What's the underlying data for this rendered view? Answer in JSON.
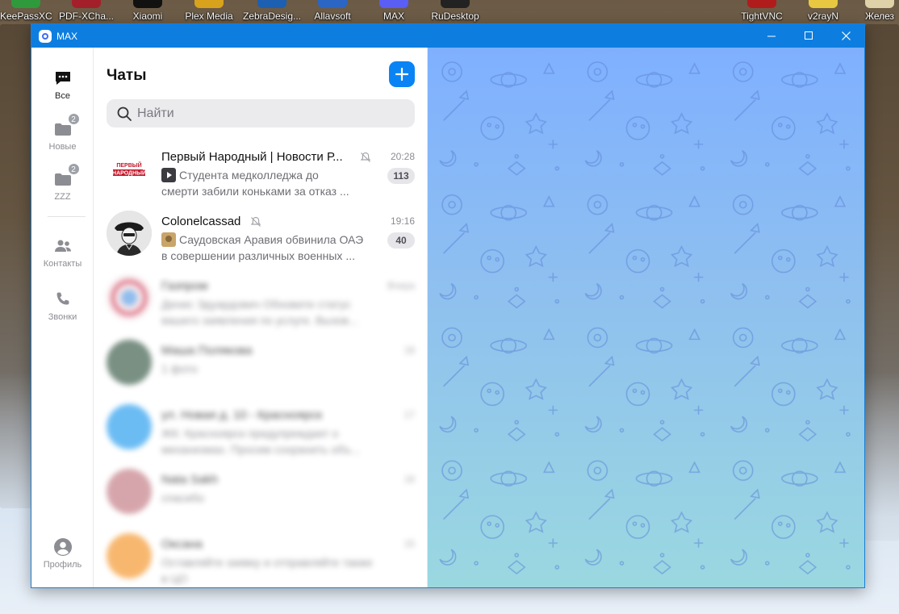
{
  "desktop": {
    "icons": [
      {
        "label": "KeePassXC",
        "color": "#2e9a3c"
      },
      {
        "label": "PDF-XCha...",
        "color": "#a3202a"
      },
      {
        "label": "Xiaomi",
        "color": "#111111"
      },
      {
        "label": "Plex Media",
        "color": "#d8a21c"
      },
      {
        "label": "ZebraDesig...",
        "color": "#1d5fb0"
      },
      {
        "label": "Allavsoft",
        "color": "#2b66c4"
      },
      {
        "label": "MAX",
        "color": "#5b5ef4"
      },
      {
        "label": "RuDesktop",
        "color": "#222222"
      },
      {
        "label": "TightVNC",
        "color": "#b01c1c"
      },
      {
        "label": "v2rayN",
        "color": "#e8c840"
      },
      {
        "label": "Желез",
        "color": "#e0d2a8"
      }
    ]
  },
  "window": {
    "title": "MAX",
    "controls": [
      "minimize-icon",
      "maximize-icon",
      "close-icon"
    ]
  },
  "rail": {
    "items": [
      {
        "label": "Все",
        "icon": "chat-bubble-icon",
        "badge": "",
        "active": true
      },
      {
        "label": "Новые",
        "icon": "folder-icon",
        "badge": "2",
        "active": false
      },
      {
        "label": "ZZZ",
        "icon": "folder-icon",
        "badge": "2",
        "active": false
      },
      {
        "label": "Контакты",
        "icon": "contacts-icon",
        "badge": "",
        "active": false
      },
      {
        "label": "Звонки",
        "icon": "phone-icon",
        "badge": "",
        "active": false
      },
      {
        "label": "Профиль",
        "icon": "profile-icon",
        "badge": "",
        "active": false
      }
    ]
  },
  "chatlist": {
    "title": "Чаты",
    "search_placeholder": "Найти",
    "chats": [
      {
        "name": "Первый Народный | Новости Р...",
        "time": "20:28",
        "muted": true,
        "preview_line1": "Студента медколледжа до",
        "preview_line2": "смерти забили коньками за отказ ...",
        "count": "113",
        "avatar_text": "Первый народный",
        "blurred": false
      },
      {
        "name": "Colonelcassad",
        "time": "19:16",
        "muted": true,
        "preview_line1": "Саудовская Аравия обвинила ОАЭ",
        "preview_line2": "в совершении различных военных ...",
        "count": "40",
        "avatar_text": "",
        "blurred": false
      },
      {
        "name": "Газпром",
        "time": "Вчера",
        "preview_line1": "Денис Эдуардович Обновите статус",
        "preview_line2": "вашего заявления по услуге. Вызов...",
        "count": "",
        "avatar_color": "#e9d8dd",
        "blurred": true
      },
      {
        "name": "Маша Полякова",
        "time": "18",
        "preview_line1": "1 фото",
        "preview_line2": "",
        "count": "",
        "avatar_color": "#4d6b5a",
        "blurred": true
      },
      {
        "name": "ул. Новая д. 10 - Красноярск",
        "time": "17",
        "preview_line1": "ЖК: Красноярск предупреждает о",
        "preview_line2": "механизмах. Просим сохранить объ...",
        "count": "",
        "avatar_color": "#3aa6f0",
        "blurred": true
      },
      {
        "name": "Nata Sakh",
        "time": "16",
        "preview_line1": "спасибо",
        "preview_line2": "",
        "count": "",
        "avatar_color": "#c88890",
        "blurred": true
      },
      {
        "name": "Оксана",
        "time": "15",
        "preview_line1": "Оставляйте заявку и отправляйте также",
        "preview_line2": "в ЦО",
        "count": "",
        "avatar_color": "#f5a040",
        "blurred": true
      }
    ]
  },
  "colors": {
    "accent": "#0a84f5",
    "titlebar": "#0d7ee0",
    "pane_top": "#7fb0ff",
    "pane_bottom": "#9ad8e0"
  }
}
